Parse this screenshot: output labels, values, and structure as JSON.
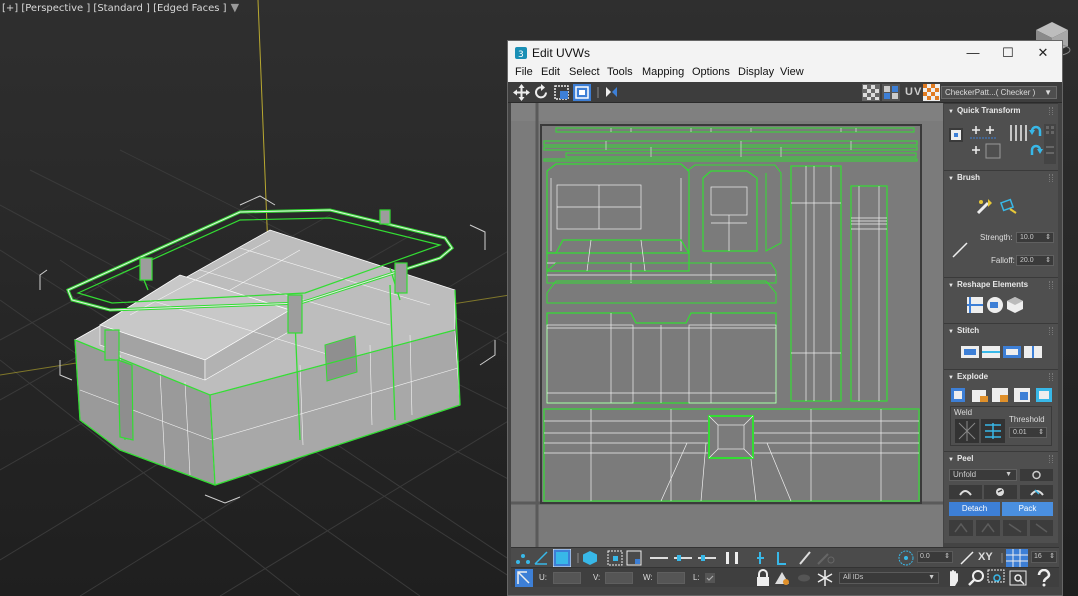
{
  "viewport": {
    "label": "[+] [Perspective ] [Standard ] [Edged Faces ]",
    "filter_icon": "funnel-icon",
    "viewcube_icon": "viewcube-icon"
  },
  "window": {
    "title": "Edit UVWs",
    "app_icon": "max-app-icon",
    "controls": {
      "minimize": "—",
      "maximize": "☐",
      "close": "✕"
    }
  },
  "menu": [
    "File",
    "Edit",
    "Select",
    "Tools",
    "Mapping",
    "Options",
    "Display",
    "View"
  ],
  "toolbar": {
    "left_icons": [
      "move-icon",
      "rotate-icon",
      "scale-icon",
      "freeform-icon",
      "mirror-icon"
    ],
    "right_icons": [
      "checker-toggle-icon",
      "show-map-icon"
    ],
    "uv_label": "UV",
    "texture_dropdown": "CheckerPatt...( Checker )"
  },
  "panel": {
    "quick_transform": {
      "title": "Quick Transform"
    },
    "brush": {
      "title": "Brush",
      "strength_label": "Strength:",
      "strength_value": "10.0",
      "falloff_label": "Falloff:",
      "falloff_value": "20.0"
    },
    "reshape": {
      "title": "Reshape Elements"
    },
    "stitch": {
      "title": "Stitch"
    },
    "explode": {
      "title": "Explode",
      "weld_label": "Weld",
      "threshold_label": "Threshold",
      "threshold_value": "0.01"
    },
    "peel": {
      "title": "Peel",
      "unfold_label": "Unfold",
      "detach_label": "Detach",
      "pack_label": "Pack"
    }
  },
  "bottom": {
    "angle_value": "0.0",
    "xy_label": "XY",
    "grid_value": "16",
    "u_label": "U:",
    "v_label": "V:",
    "w_label": "W:",
    "l_label": "L:",
    "id_dropdown": "All IDs"
  },
  "colors": {
    "selection_green": "#33dd33",
    "uv_canvas": "#7d7d7d",
    "accent_blue": "#3d7fd6"
  }
}
